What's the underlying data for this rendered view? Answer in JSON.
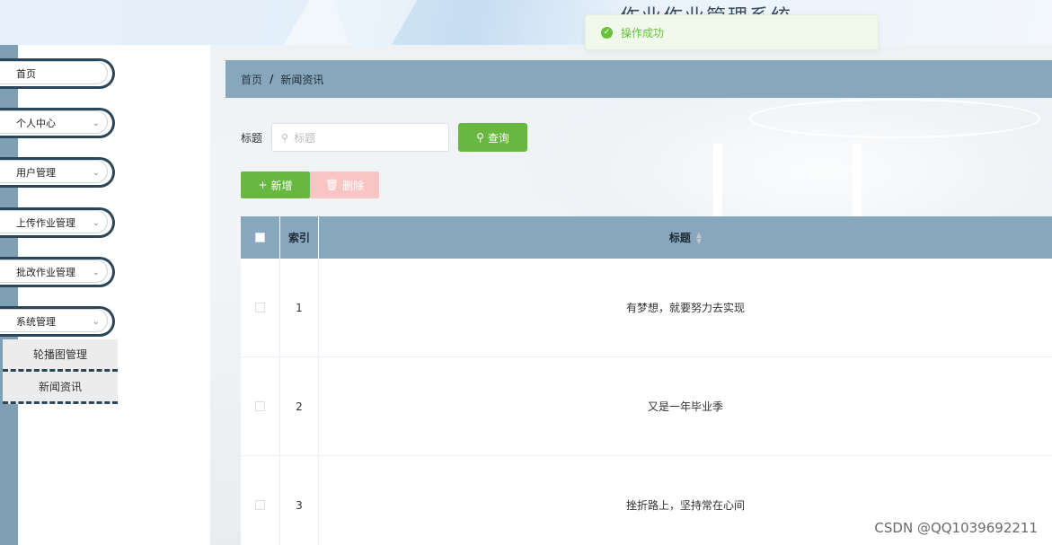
{
  "header": {
    "system_title": "作业作业管理系统"
  },
  "toast": {
    "message": "操作成功"
  },
  "sidebar": {
    "items": [
      {
        "label": "首页",
        "has_chevron": false
      },
      {
        "label": "个人中心",
        "has_chevron": true
      },
      {
        "label": "用户管理",
        "has_chevron": true
      },
      {
        "label": "上传作业管理",
        "has_chevron": true
      },
      {
        "label": "批改作业管理",
        "has_chevron": true
      },
      {
        "label": "系统管理",
        "has_chevron": true
      }
    ],
    "sub_items": [
      {
        "label": "轮播图管理"
      },
      {
        "label": "新闻资讯"
      }
    ]
  },
  "breadcrumb": {
    "home": "首页",
    "separator": "/",
    "current": "新闻资讯"
  },
  "search": {
    "label": "标题",
    "placeholder": "标题",
    "button_label": "查询"
  },
  "actions": {
    "add_label": "新增",
    "delete_label": "删除"
  },
  "table": {
    "headers": {
      "index": "索引",
      "title": "标题"
    },
    "rows": [
      {
        "index": "1",
        "title": "有梦想，就要努力去实现"
      },
      {
        "index": "2",
        "title": "又是一年毕业季"
      },
      {
        "index": "3",
        "title": "挫折路上，坚持常在心间"
      }
    ]
  },
  "watermark": "CSDN @QQ1039692211",
  "colors": {
    "accent_green": "#67b741",
    "header_blue": "#88a7bd",
    "sidebar_border": "#2b4559",
    "delete_disabled": "#fbc4c4",
    "toast_bg": "#f0f9eb"
  }
}
